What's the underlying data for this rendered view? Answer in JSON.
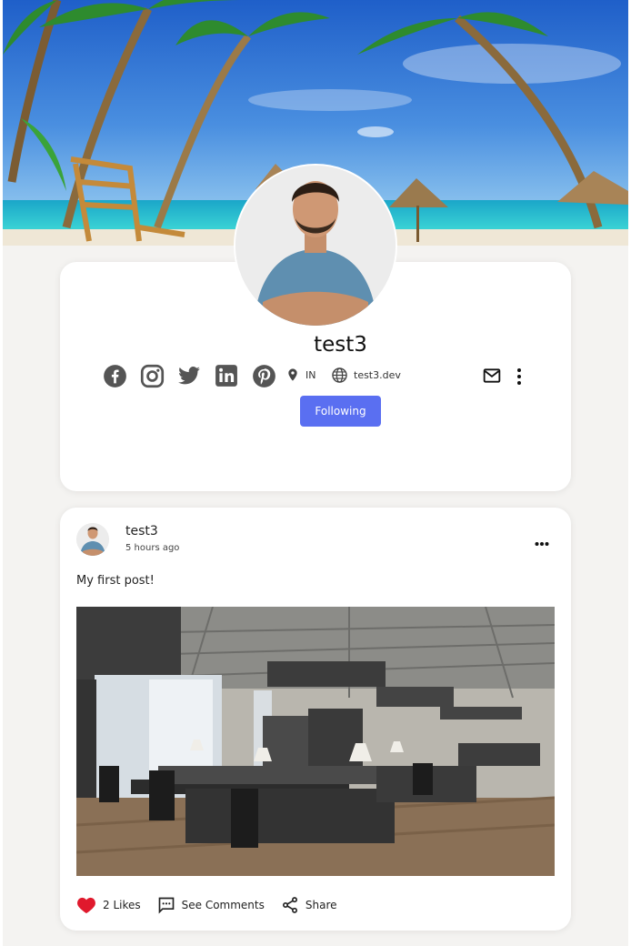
{
  "profile": {
    "username": "test3",
    "location": "IN",
    "website": "test3.dev",
    "follow_button_label": "Following",
    "socials": [
      "facebook-icon",
      "instagram-icon",
      "twitter-icon",
      "linkedin-icon",
      "pinterest-icon"
    ]
  },
  "post": {
    "author": "test3",
    "time": "5 hours ago",
    "text": "My first post!",
    "likes_label": "2 Likes",
    "comments_label": "See Comments",
    "share_label": "Share"
  },
  "colors": {
    "accent": "#5a6ff1",
    "like": "#e0192d",
    "page_bg": "#f4f3f1"
  }
}
